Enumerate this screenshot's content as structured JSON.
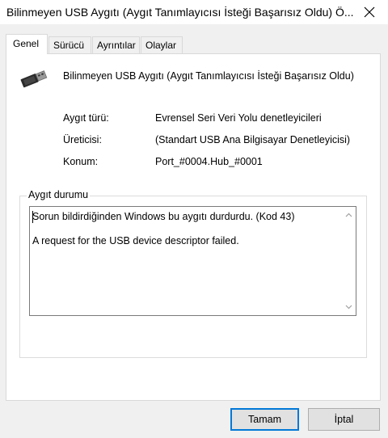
{
  "window": {
    "title": "Bilinmeyen USB Aygıtı (Aygıt Tanımlayıcısı İsteği Başarısız Oldu) Ö..."
  },
  "tabs": [
    {
      "label": "Genel",
      "active": true
    },
    {
      "label": "Sürücü",
      "active": false
    },
    {
      "label": "Ayrıntılar",
      "active": false
    },
    {
      "label": "Olaylar",
      "active": false
    }
  ],
  "device": {
    "name": "Bilinmeyen USB Aygıtı (Aygıt Tanımlayıcısı İsteği Başarısız Oldu)",
    "icon": "usb-connector-icon"
  },
  "properties": [
    {
      "label": "Aygıt türü:",
      "value": "Evrensel Seri Veri Yolu denetleyicileri"
    },
    {
      "label": "Üreticisi:",
      "value": "(Standart USB Ana Bilgisayar Denetleyicisi)"
    },
    {
      "label": "Konum:",
      "value": "Port_#0004.Hub_#0001"
    }
  ],
  "status": {
    "group_label": "Aygıt durumu",
    "line1": "Sorun bildirdiğinden Windows bu aygıtı durdurdu. (Kod 43)",
    "line2": "A request for the USB device descriptor failed."
  },
  "buttons": {
    "ok": "Tamam",
    "cancel": "İptal"
  },
  "colors": {
    "window_bg": "#f0f0f0",
    "panel_bg": "#ffffff",
    "focus_border": "#0078d7",
    "button_bg": "#e1e1e1"
  }
}
